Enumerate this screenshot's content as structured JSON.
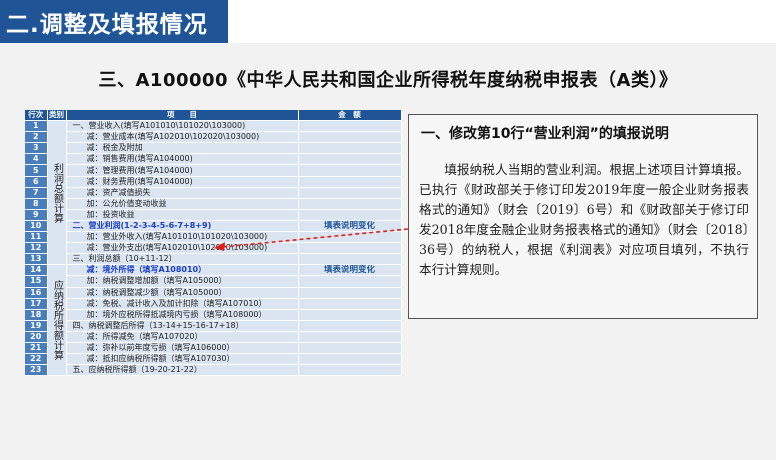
{
  "section_title": "二.调整及填报情况",
  "heading": "三、A100000《中华人民共和国企业所得税年度纳税申报表（A类）》",
  "table": {
    "headers": {
      "row": "行次",
      "category": "类别",
      "item": "项　　目",
      "amount": "金　额"
    },
    "categories": [
      {
        "label": "利润总额计算",
        "rows": 13
      },
      {
        "label": "应纳税所得额计算",
        "rows": 10
      }
    ],
    "rows": [
      {
        "no": "1",
        "item": "一、营业收入(填写A101010\\101020\\103000)",
        "amount": ""
      },
      {
        "no": "2",
        "item": "减：营业成本(填写A102010\\102020\\103000)",
        "amount": ""
      },
      {
        "no": "3",
        "item": "减：税金及附加",
        "amount": ""
      },
      {
        "no": "4",
        "item": "减：销售费用(填写A104000)",
        "amount": ""
      },
      {
        "no": "5",
        "item": "减：管理费用(填写A104000)",
        "amount": ""
      },
      {
        "no": "6",
        "item": "减：财务费用(填写A104000)",
        "amount": ""
      },
      {
        "no": "7",
        "item": "减：资产减值损失",
        "amount": ""
      },
      {
        "no": "8",
        "item": "加：公允价值变动收益",
        "amount": ""
      },
      {
        "no": "9",
        "item": "加：投资收益",
        "amount": ""
      },
      {
        "no": "10",
        "item": "二、营业利润(1-2-3-4-5-6-7+8+9)",
        "amount": "填表说明变化",
        "highlight": true
      },
      {
        "no": "11",
        "item": "加：营业外收入(填写A101010\\101020\\103000)",
        "amount": ""
      },
      {
        "no": "12",
        "item": "减：营业外支出(填写A102010\\102020\\103000)",
        "amount": ""
      },
      {
        "no": "13",
        "item": "三、利润总额（10+11-12）",
        "amount": ""
      },
      {
        "no": "14",
        "item": "减：境外所得（填写A108010）",
        "amount": "填表说明变化",
        "highlight": true
      },
      {
        "no": "15",
        "item": "加：纳税调整增加额（填写A105000）",
        "amount": ""
      },
      {
        "no": "16",
        "item": "减：纳税调整减少额（填写A105000）",
        "amount": ""
      },
      {
        "no": "17",
        "item": "减：免税、减计收入及加计扣除（填写A107010）",
        "amount": ""
      },
      {
        "no": "18",
        "item": "加：境外应税所得抵减境内亏损（填写A108000）",
        "amount": ""
      },
      {
        "no": "19",
        "item": "四、纳税调整后所得（13-14+15-16-17+18）",
        "amount": ""
      },
      {
        "no": "20",
        "item": "减：所得减免（填写A107020）",
        "amount": ""
      },
      {
        "no": "21",
        "item": "减：弥补以前年度亏损（填写A106000）",
        "amount": ""
      },
      {
        "no": "22",
        "item": "减：抵扣应纳税所得额（填写A107030）",
        "amount": ""
      },
      {
        "no": "23",
        "item": "五、应纳税所得额（19-20-21-22）",
        "amount": ""
      }
    ]
  },
  "note": {
    "title": "一、修改第10行“营业利润”的填报说明",
    "body": "填报纳税人当期的营业利润。根据上述项目计算填报。已执行《财政部关于修订印发2019年度一般企业财务报表格式的通知》（财会〔2019〕6号）和《财政部关于修订印发2018年度金融企业财务报表格式的通知》（财会〔2018〕36号）的纳税人，根据《利润表》对应项目填列，不执行本行计算规则。"
  },
  "colors": {
    "header_blue": "#1f5597",
    "row_fill": "#dbe5f1",
    "arrow": "#e0201b"
  }
}
